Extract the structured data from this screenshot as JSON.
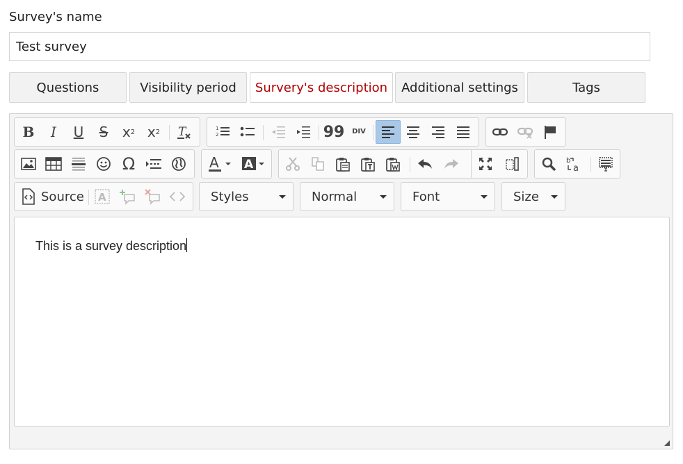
{
  "form": {
    "name_label": "Survey's name",
    "name_value": "Test survey"
  },
  "tabs": [
    {
      "label": "Questions",
      "active": false
    },
    {
      "label": "Visibility period",
      "active": false
    },
    {
      "label": "Survery's description",
      "active": true
    },
    {
      "label": "Additional settings",
      "active": false
    },
    {
      "label": "Tags",
      "active": false
    }
  ],
  "colors": {
    "active_tab_text": "#b00000",
    "active_button_bg": "#a9c8e8"
  },
  "toolbar": {
    "basic": [
      "bold-icon",
      "italic-icon",
      "underline-icon",
      "strikethrough-icon",
      "subscript-icon",
      "superscript-icon",
      "remove-format-icon"
    ],
    "paragraph": [
      "numbered-list-icon",
      "bulleted-list-icon",
      "outdent-icon",
      "indent-icon",
      "blockquote-icon",
      "div-container-icon",
      "align-left-icon",
      "align-center-icon",
      "align-right-icon",
      "justify-icon"
    ],
    "links": [
      "link-icon",
      "unlink-icon",
      "anchor-flag-icon"
    ],
    "insert": [
      "image-icon",
      "table-icon",
      "horizontal-line-icon",
      "smiley-icon",
      "special-char-icon",
      "page-break-icon",
      "iframe-globe-icon"
    ],
    "colors": [
      "text-color-icon",
      "background-color-icon"
    ],
    "clipboard": [
      "cut-icon",
      "copy-icon",
      "paste-icon",
      "paste-text-icon",
      "paste-word-icon",
      "undo-icon",
      "redo-icon"
    ],
    "tools": [
      "maximize-icon",
      "show-blocks-icon"
    ],
    "find": [
      "find-icon",
      "replace-icon",
      "select-all-icon"
    ],
    "source_label": "Source",
    "styles_label": "Styles",
    "format_label": "Normal",
    "font_label": "Font",
    "size_label": "Size",
    "text_color_letter": "A",
    "bg_color_letter": "A",
    "bold_glyph": "B",
    "italic_glyph": "I",
    "underline_glyph": "U",
    "strike_glyph": "S",
    "sub_glyph": "x",
    "sub_small": "2",
    "sup_glyph": "x",
    "sup_small": "2",
    "omega_glyph": "Ω",
    "quote_glyph": "99",
    "div_glyph": "DIV"
  },
  "editor": {
    "content": "This is a survey description"
  }
}
